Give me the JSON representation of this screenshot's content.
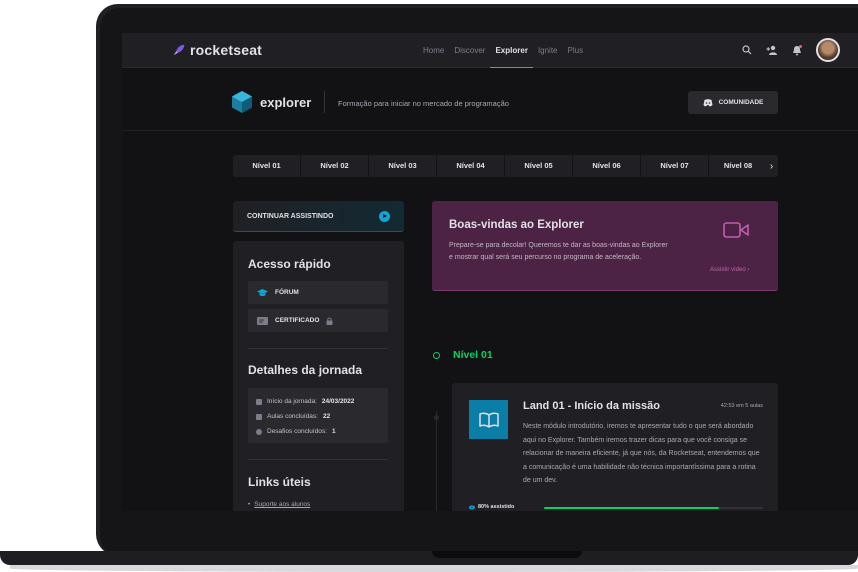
{
  "header": {
    "brand": "rocketseat",
    "nav": [
      "Home",
      "Discover",
      "Explorer",
      "Ignite",
      "Plus"
    ],
    "active_nav": "Explorer"
  },
  "explorer": {
    "title": "explorer",
    "description": "Formação para iniciar no mercado de programação",
    "community_button": "COMUNIDADE"
  },
  "levels": [
    "Nível 01",
    "Nível 02",
    "Nível 03",
    "Nível 04",
    "Nível 05",
    "Nível 06",
    "Nível 07",
    "Nível 08"
  ],
  "sidebar": {
    "continue_label": "CONTINUAR ASSISTINDO",
    "quick_access_title": "Acesso rápido",
    "forum_label": "FÓRUM",
    "certificate_label": "CERTIFICADO",
    "details_title": "Detalhes da jornada",
    "start_label": "Início da jornada:",
    "start_value": "24/03/2022",
    "classes_label": "Aulas concluídas:",
    "classes_value": "22",
    "challenges_label": "Desafios concluídos:",
    "challenges_value": "1",
    "links_title": "Links úteis",
    "support_link": "Suporte aos alunos"
  },
  "welcome": {
    "title": "Boas-vindas ao Explorer",
    "text": "Prepare-se para decolar! Queremos te dar as boas-vindas ao Explorer e mostrar qual será seu percurso no programa de aceleração.",
    "watch_link": "Assistir vídeo  ›"
  },
  "level_section": {
    "title": "Nível 01"
  },
  "module": {
    "title": "Land 01 - Início da missão",
    "meta": "42:53 em 5 aulas",
    "description": "Neste módulo introdutório, iremos te apresentar tudo o que será abordado aqui no Explorer. Também iremos trazer dicas para que você consiga se relacionar de maneira eficiente, já que nós, da Rocketseat, entendemos que a comunicação é uma habilidade não técnica importantíssima para a rotina de um dev.",
    "progress_label": "80% assistido",
    "progress": 0.8
  },
  "colors": {
    "accent": "#04d361",
    "purple": "#4c2345",
    "blue": "#0b7ea8"
  }
}
